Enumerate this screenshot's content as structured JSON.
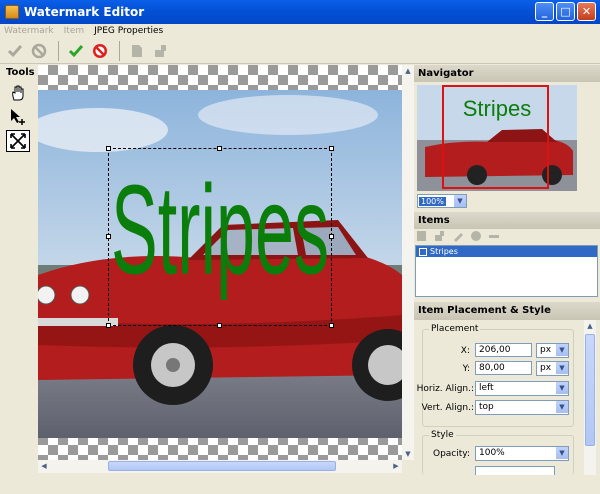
{
  "window": {
    "title": "Watermark Editor"
  },
  "menu": {
    "watermark": "Watermark",
    "item": "Item",
    "jpeg": "JPEG Properties"
  },
  "tools": {
    "title": "Tools"
  },
  "watermark": {
    "text": "Stripes",
    "color": "#0b7d0b"
  },
  "navigator": {
    "title": "Navigator",
    "zoom": "100%"
  },
  "items": {
    "title": "Items",
    "list": [
      "Stripes"
    ]
  },
  "placement": {
    "title": "Item Placement & Style",
    "group": "Placement",
    "x_label": "X:",
    "x_value": "206,00",
    "x_unit": "px",
    "y_label": "Y:",
    "y_value": "80,00",
    "y_unit": "px",
    "halign_label": "Horiz. Align.:",
    "halign_value": "left",
    "valign_label": "Vert. Align.:",
    "valign_value": "top"
  },
  "style": {
    "group": "Style",
    "opacity_label": "Opacity:",
    "opacity_value": "100%"
  },
  "colors": {
    "titlebar": "#0451d6",
    "selection": "#316ac5",
    "frame": "#d11111"
  }
}
